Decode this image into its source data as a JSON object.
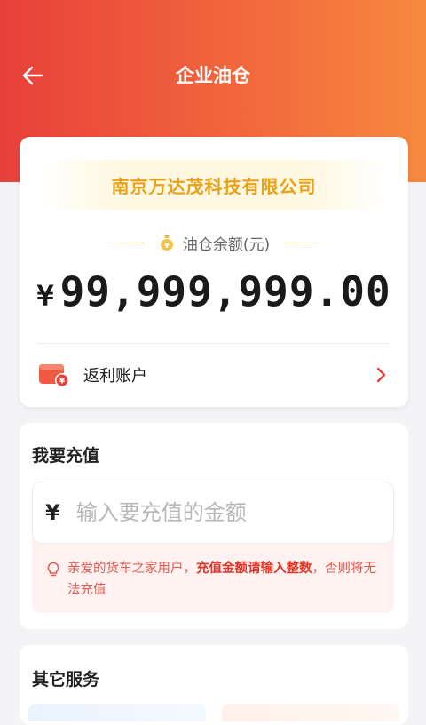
{
  "header": {
    "title": "企业油仓",
    "back_icon": "arrow-left-icon",
    "gradient": [
      "#e8403a",
      "#f7893f"
    ]
  },
  "account": {
    "company": "南京万达茂科技有限公司",
    "balance_label": "油仓余额(元)",
    "currency": "¥",
    "balance": "99,999,999.00",
    "rebate_label": "返利账户",
    "rebate_icon": "wallet-yen-icon"
  },
  "recharge": {
    "title": "我要充值",
    "currency": "¥",
    "placeholder": "输入要充值的金额",
    "value": "",
    "tip_prefix": "亲爱的货车之家用户，",
    "tip_highlight": "充值金额请输入整数",
    "tip_suffix": "，否则将无法充值",
    "tip_icon": "lightbulb-icon"
  },
  "other": {
    "title": "其它服务"
  },
  "colors": {
    "accent": "#e8403a",
    "gold": "#e7a21b",
    "tip_text": "#e25a52"
  }
}
